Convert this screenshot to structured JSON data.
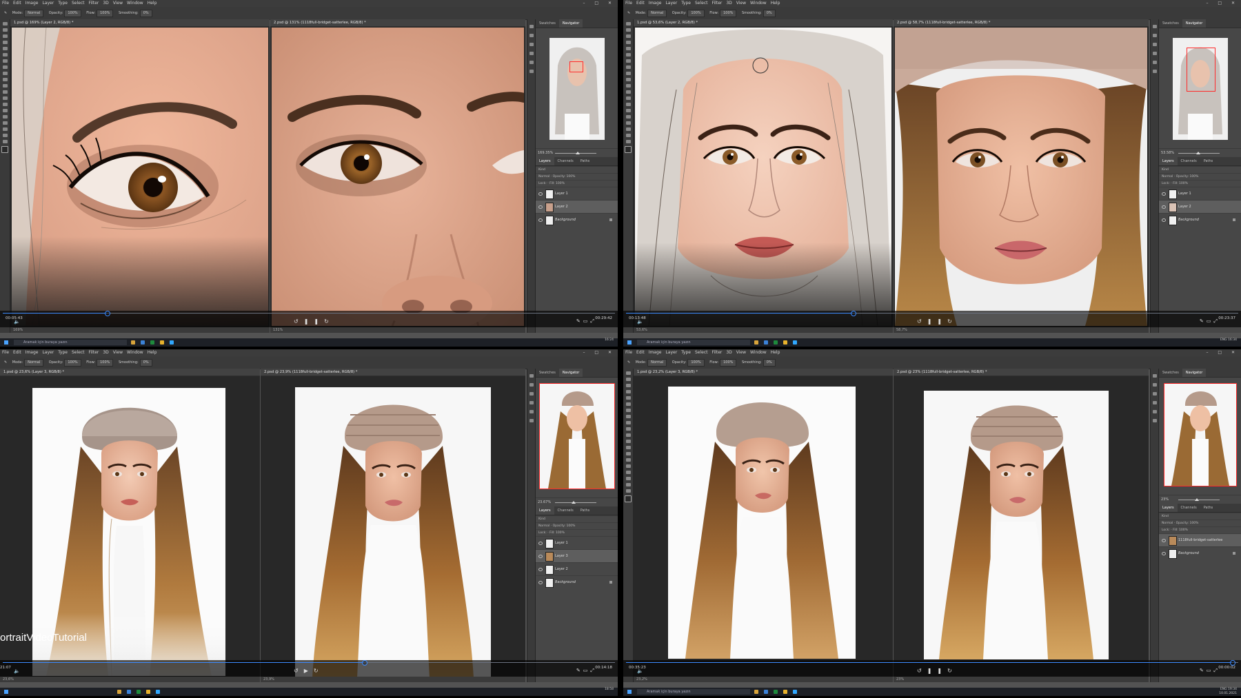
{
  "menu": [
    "File",
    "Edit",
    "Image",
    "Layer",
    "Type",
    "Select",
    "Filter",
    "3D",
    "View",
    "Window",
    "Help"
  ],
  "options": {
    "mode_label": "Mode:",
    "mode_value": "Normal",
    "opacity_label": "Opacity:",
    "opacity_value": "100%",
    "flow_label": "Flow:",
    "flow_value": "100%",
    "smoothing_label": "Smoothing:",
    "smoothing_value": "0%"
  },
  "panel": {
    "tab_swatches": "Swatches",
    "tab_navigator": "Navigator",
    "tab_layers": "Layers",
    "tab_channels": "Channels",
    "tab_paths": "Paths",
    "kind": "Kind",
    "blend": "Normal",
    "opacity": "Opacity: 100%",
    "lock": "Lock:",
    "fill": "Fill: 100%"
  },
  "taskbar": {
    "search_placeholder": "Aramak için buraya yazın",
    "lang": "ENG"
  },
  "quads": [
    {
      "doc1_tab": "1.psd @ 169% (Layer 2, RGB/8) *",
      "doc2_tab": "2.psd @ 131% (1118full-bridget-satterlee, RGB/8) *",
      "doc1_status": "169%",
      "doc2_status": "131%",
      "nav_zoom": "169.35%",
      "layers": [
        "Layer 1",
        "Layer 2",
        "Background"
      ],
      "time_left": "00:05:43",
      "time_right": "00:29:42",
      "clock": "16:24",
      "progress": 0.17
    },
    {
      "doc1_tab": "1.psd @ 53,6% (Layer 2, RGB/8) *",
      "doc2_tab": "2.psd @ 58,7% (1118full-bridget-satterlee, RGB/8) *",
      "doc1_status": "53,6%",
      "doc2_status": "58,7%",
      "nav_zoom": "53.58%",
      "layers": [
        "Layer 1",
        "Layer 2",
        "Background"
      ],
      "time_left": "00:13:48",
      "time_right": "00:23:37",
      "clock": "16:34",
      "progress": 0.37
    },
    {
      "doc1_tab": "1.psd @ 23,6% (Layer 3, RGB/8) *",
      "doc2_tab": "2.psd @ 23,9% (1118full-bridget-satterlee, RGB/8) *",
      "doc1_status": "23,6%",
      "doc2_status": "23,9%",
      "nav_zoom": "23.67%",
      "layers": [
        "Layer 1",
        "Layer 3",
        "Layer 2",
        "Background"
      ],
      "time_left": "21:07",
      "time_right": "00:14:18",
      "clock": "18:58",
      "progress": 0.59,
      "overlay_text": "ortraitVideoTutorial"
    },
    {
      "doc1_tab": "1.psd @ 23,2% (Layer 3, RGB/8) *",
      "doc2_tab": "2.psd @ 23% (1118full-bridget-satterlee, RGB/8) *",
      "doc1_status": "23,2%",
      "doc2_status": "23%",
      "nav_zoom": "23%",
      "layers": [
        "1118full-bridget-satterlee",
        "Background"
      ],
      "time_left": "00:35:23",
      "time_right": "00:00:02",
      "clock": "19:34",
      "date": "10.01.2021",
      "progress": 0.99
    }
  ]
}
